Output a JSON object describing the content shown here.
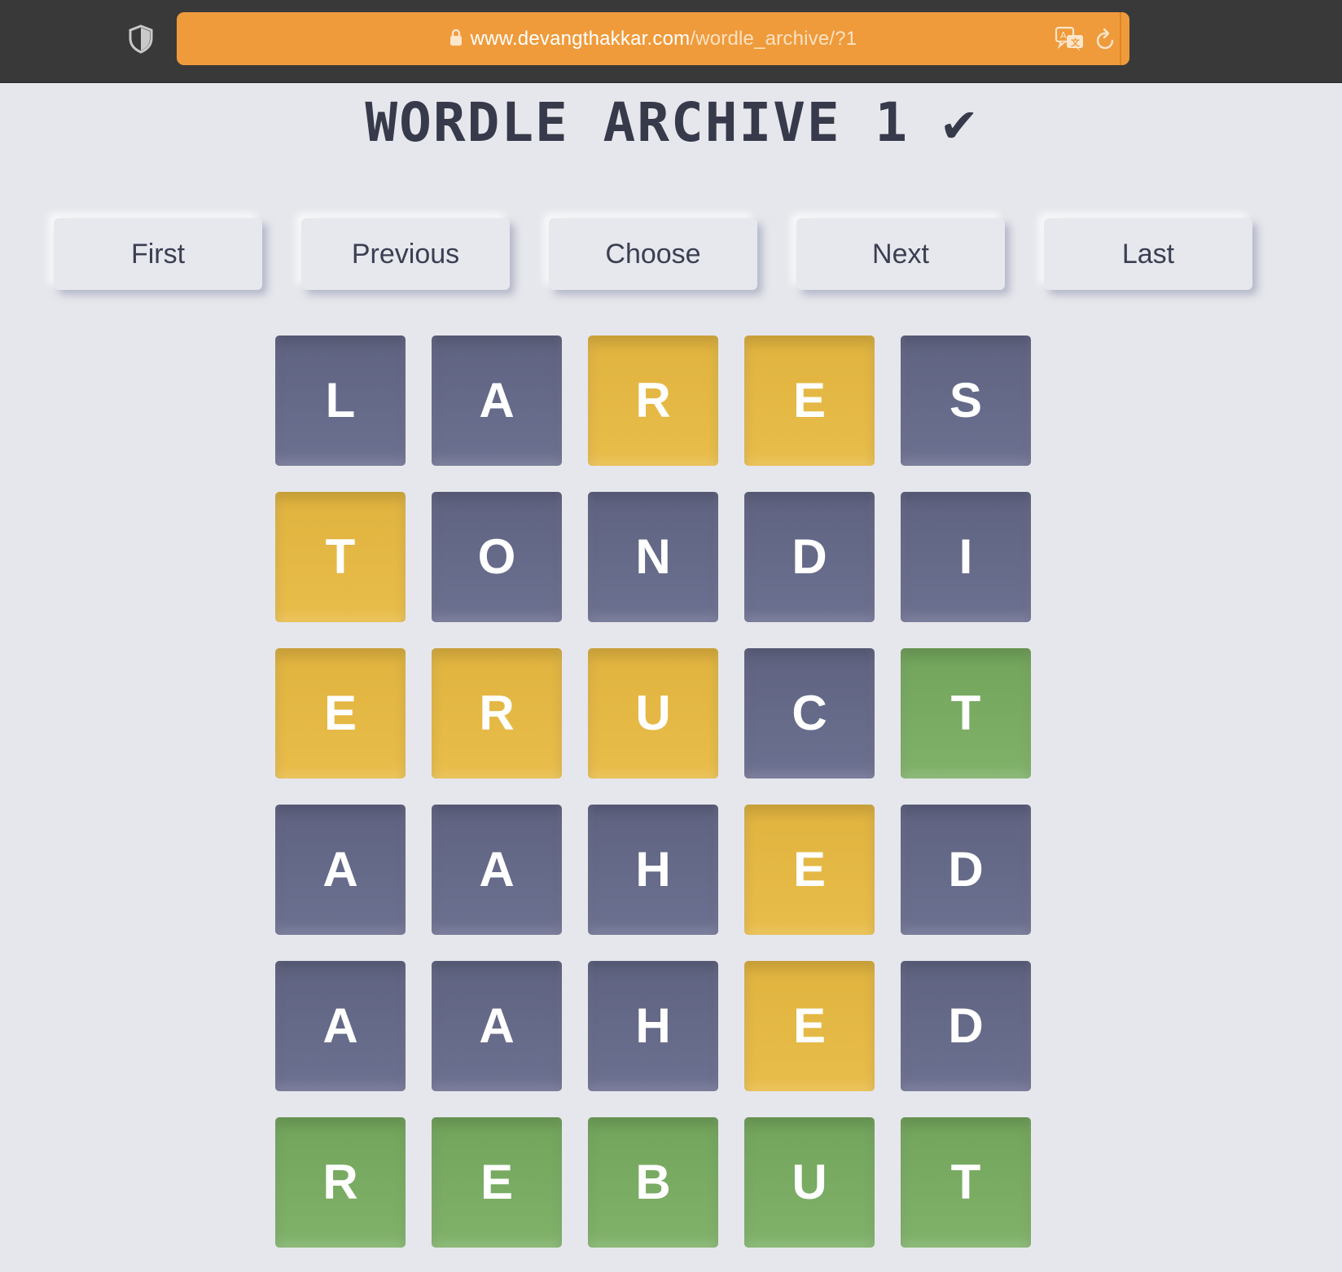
{
  "browser": {
    "url_domain": "www.devangthakkar.com",
    "url_path": "/wordle_archive/?1",
    "icons": [
      "shield-icon",
      "lock-icon",
      "translate-icon",
      "reload-icon"
    ],
    "url_bar_color": "#ef9b3b"
  },
  "page": {
    "title": "WORDLE ARCHIVE 1 ✔",
    "background": "#e6e7ec"
  },
  "nav": {
    "first": "First",
    "previous": "Previous",
    "choose": "Choose",
    "next": "Next",
    "last": "Last"
  },
  "colors": {
    "absent": "#62667f",
    "present": "#e3b644",
    "correct": "#77a861"
  },
  "board": {
    "rows": [
      {
        "tiles": [
          {
            "letter": "L",
            "state": "absent"
          },
          {
            "letter": "A",
            "state": "absent"
          },
          {
            "letter": "R",
            "state": "present"
          },
          {
            "letter": "E",
            "state": "present"
          },
          {
            "letter": "S",
            "state": "absent"
          }
        ]
      },
      {
        "tiles": [
          {
            "letter": "T",
            "state": "present"
          },
          {
            "letter": "O",
            "state": "absent"
          },
          {
            "letter": "N",
            "state": "absent"
          },
          {
            "letter": "D",
            "state": "absent"
          },
          {
            "letter": "I",
            "state": "absent"
          }
        ]
      },
      {
        "tiles": [
          {
            "letter": "E",
            "state": "present"
          },
          {
            "letter": "R",
            "state": "present"
          },
          {
            "letter": "U",
            "state": "present"
          },
          {
            "letter": "C",
            "state": "absent"
          },
          {
            "letter": "T",
            "state": "correct"
          }
        ]
      },
      {
        "tiles": [
          {
            "letter": "A",
            "state": "absent"
          },
          {
            "letter": "A",
            "state": "absent"
          },
          {
            "letter": "H",
            "state": "absent"
          },
          {
            "letter": "E",
            "state": "present"
          },
          {
            "letter": "D",
            "state": "absent"
          }
        ]
      },
      {
        "tiles": [
          {
            "letter": "A",
            "state": "absent"
          },
          {
            "letter": "A",
            "state": "absent"
          },
          {
            "letter": "H",
            "state": "absent"
          },
          {
            "letter": "E",
            "state": "present"
          },
          {
            "letter": "D",
            "state": "absent"
          }
        ]
      },
      {
        "tiles": [
          {
            "letter": "R",
            "state": "correct"
          },
          {
            "letter": "E",
            "state": "correct"
          },
          {
            "letter": "B",
            "state": "correct"
          },
          {
            "letter": "U",
            "state": "correct"
          },
          {
            "letter": "T",
            "state": "correct"
          }
        ]
      }
    ]
  }
}
